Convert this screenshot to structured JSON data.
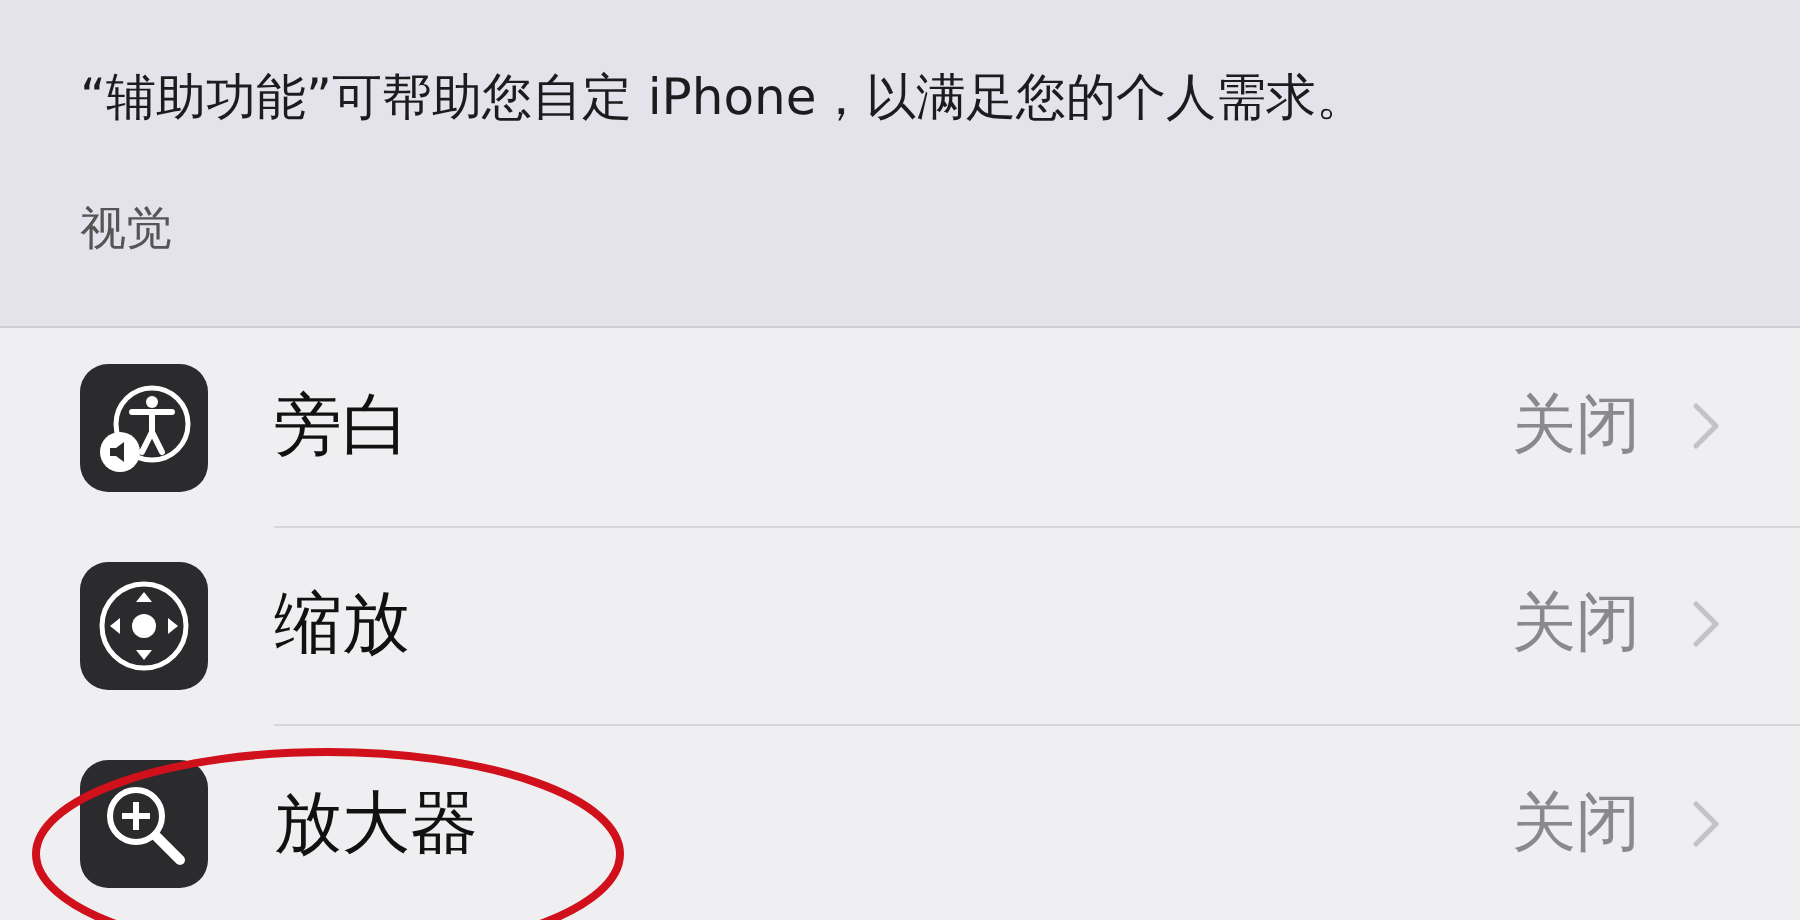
{
  "description": "“辅助功能”可帮助您自定 iPhone，以满足您的个人需求。",
  "section_title": "视觉",
  "rows": [
    {
      "kind": "voiceover",
      "label": "旁白",
      "value": "关闭",
      "highlighted": false
    },
    {
      "kind": "zoom",
      "label": "缩放",
      "value": "关闭",
      "highlighted": false
    },
    {
      "kind": "magnifier",
      "label": "放大器",
      "value": "关闭",
      "highlighted": true
    }
  ]
}
